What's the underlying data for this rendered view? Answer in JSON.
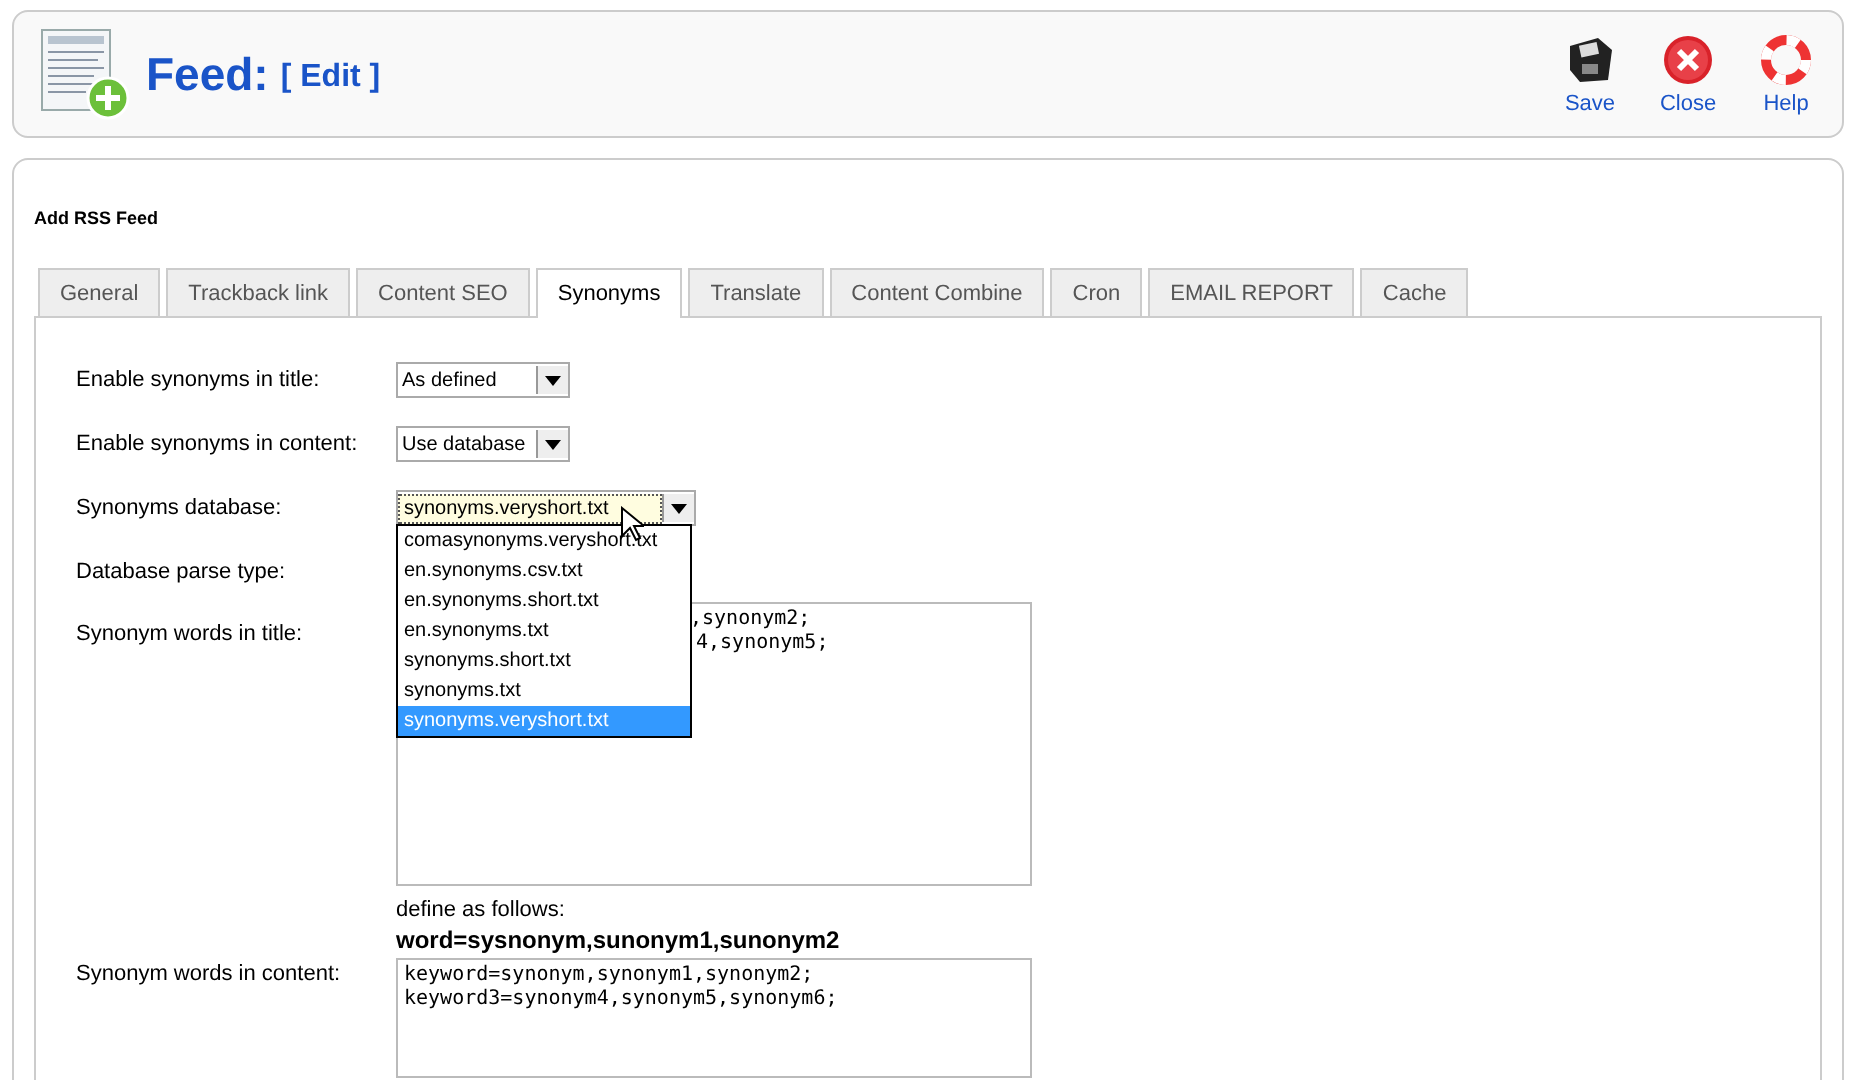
{
  "header": {
    "title": "Feed:",
    "subtitle": "[ Edit ]",
    "actions": [
      {
        "kind": "save",
        "label": "Save"
      },
      {
        "kind": "close",
        "label": "Close"
      },
      {
        "kind": "help",
        "label": "Help"
      }
    ]
  },
  "section_title": "Add RSS Feed",
  "tabs": [
    {
      "label": "General",
      "selected": false
    },
    {
      "label": "Trackback link",
      "selected": false
    },
    {
      "label": "Content SEO",
      "selected": false
    },
    {
      "label": "Synonyms",
      "selected": true
    },
    {
      "label": "Translate",
      "selected": false
    },
    {
      "label": "Content Combine",
      "selected": false
    },
    {
      "label": "Cron",
      "selected": false
    },
    {
      "label": "EMAIL REPORT",
      "selected": false
    },
    {
      "label": "Cache",
      "selected": false
    }
  ],
  "form": {
    "enable_title": {
      "label": "Enable synonyms in title:",
      "value": "As defined"
    },
    "enable_content": {
      "label": "Enable synonyms in content:",
      "value": "Use database"
    },
    "database": {
      "label": "Synonyms database:",
      "value": "synonyms.veryshort.txt",
      "expanded": true,
      "options": [
        {
          "label": "comasynonyms.veryshort.txt",
          "selected": false
        },
        {
          "label": "en.synonyms.csv.txt",
          "selected": false
        },
        {
          "label": "en.synonyms.short.txt",
          "selected": false
        },
        {
          "label": "en.synonyms.txt",
          "selected": false
        },
        {
          "label": "synonyms.short.txt",
          "selected": false
        },
        {
          "label": "synonyms.txt",
          "selected": false
        },
        {
          "label": "synonyms.veryshort.txt",
          "selected": true
        }
      ]
    },
    "parse_type": {
      "label": "Database parse type:"
    },
    "title_words": {
      "label": "Synonym words in title:",
      "lines": [
        ",synonym2;",
        "4,synonym5;"
      ]
    },
    "hint": "define as follows:",
    "hint_example": "word=sysnonym,sunonym1,sunonym2",
    "content_words": {
      "label": "Synonym words in content:",
      "lines": [
        "keyword=synonym,synonym1,synonym2;",
        "keyword3=synonym4,synonym5,synonym6;"
      ]
    }
  }
}
